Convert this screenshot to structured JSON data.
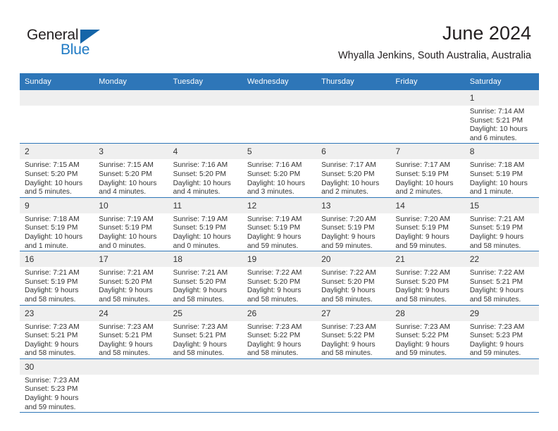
{
  "brand": {
    "name_top": "General",
    "name_bottom": "Blue",
    "triangle_icon": "triangle-icon",
    "accent_dark": "#1565a8",
    "accent_blue": "#1f7ac4"
  },
  "header": {
    "title": "June 2024",
    "subtitle": "Whyalla Jenkins, South Australia, Australia"
  },
  "theme": {
    "header_blue": "#2e76b8",
    "daynum_band": "#efefef",
    "text": "#333333"
  },
  "weekday_headers": [
    "Sunday",
    "Monday",
    "Tuesday",
    "Wednesday",
    "Thursday",
    "Friday",
    "Saturday"
  ],
  "labels": {
    "sunrise_prefix": "Sunrise:",
    "sunset_prefix": "Sunset:",
    "daylight_prefix": "Daylight:"
  },
  "weeks": [
    [
      {
        "day": "",
        "empty": true,
        "l1": "",
        "l2": "",
        "l3": "",
        "l4": ""
      },
      {
        "day": "",
        "empty": true,
        "l1": "",
        "l2": "",
        "l3": "",
        "l4": ""
      },
      {
        "day": "",
        "empty": true,
        "l1": "",
        "l2": "",
        "l3": "",
        "l4": ""
      },
      {
        "day": "",
        "empty": true,
        "l1": "",
        "l2": "",
        "l3": "",
        "l4": ""
      },
      {
        "day": "",
        "empty": true,
        "l1": "",
        "l2": "",
        "l3": "",
        "l4": ""
      },
      {
        "day": "",
        "empty": true,
        "l1": "",
        "l2": "",
        "l3": "",
        "l4": ""
      },
      {
        "day": "1",
        "empty": false,
        "l1": "Sunrise: 7:14 AM",
        "l2": "Sunset: 5:21 PM",
        "l3": "Daylight: 10 hours",
        "l4": "and 6 minutes."
      }
    ],
    [
      {
        "day": "2",
        "empty": false,
        "l1": "Sunrise: 7:15 AM",
        "l2": "Sunset: 5:20 PM",
        "l3": "Daylight: 10 hours",
        "l4": "and 5 minutes."
      },
      {
        "day": "3",
        "empty": false,
        "l1": "Sunrise: 7:15 AM",
        "l2": "Sunset: 5:20 PM",
        "l3": "Daylight: 10 hours",
        "l4": "and 4 minutes."
      },
      {
        "day": "4",
        "empty": false,
        "l1": "Sunrise: 7:16 AM",
        "l2": "Sunset: 5:20 PM",
        "l3": "Daylight: 10 hours",
        "l4": "and 4 minutes."
      },
      {
        "day": "5",
        "empty": false,
        "l1": "Sunrise: 7:16 AM",
        "l2": "Sunset: 5:20 PM",
        "l3": "Daylight: 10 hours",
        "l4": "and 3 minutes."
      },
      {
        "day": "6",
        "empty": false,
        "l1": "Sunrise: 7:17 AM",
        "l2": "Sunset: 5:20 PM",
        "l3": "Daylight: 10 hours",
        "l4": "and 2 minutes."
      },
      {
        "day": "7",
        "empty": false,
        "l1": "Sunrise: 7:17 AM",
        "l2": "Sunset: 5:19 PM",
        "l3": "Daylight: 10 hours",
        "l4": "and 2 minutes."
      },
      {
        "day": "8",
        "empty": false,
        "l1": "Sunrise: 7:18 AM",
        "l2": "Sunset: 5:19 PM",
        "l3": "Daylight: 10 hours",
        "l4": "and 1 minute."
      }
    ],
    [
      {
        "day": "9",
        "empty": false,
        "l1": "Sunrise: 7:18 AM",
        "l2": "Sunset: 5:19 PM",
        "l3": "Daylight: 10 hours",
        "l4": "and 1 minute."
      },
      {
        "day": "10",
        "empty": false,
        "l1": "Sunrise: 7:19 AM",
        "l2": "Sunset: 5:19 PM",
        "l3": "Daylight: 10 hours",
        "l4": "and 0 minutes."
      },
      {
        "day": "11",
        "empty": false,
        "l1": "Sunrise: 7:19 AM",
        "l2": "Sunset: 5:19 PM",
        "l3": "Daylight: 10 hours",
        "l4": "and 0 minutes."
      },
      {
        "day": "12",
        "empty": false,
        "l1": "Sunrise: 7:19 AM",
        "l2": "Sunset: 5:19 PM",
        "l3": "Daylight: 9 hours",
        "l4": "and 59 minutes."
      },
      {
        "day": "13",
        "empty": false,
        "l1": "Sunrise: 7:20 AM",
        "l2": "Sunset: 5:19 PM",
        "l3": "Daylight: 9 hours",
        "l4": "and 59 minutes."
      },
      {
        "day": "14",
        "empty": false,
        "l1": "Sunrise: 7:20 AM",
        "l2": "Sunset: 5:19 PM",
        "l3": "Daylight: 9 hours",
        "l4": "and 59 minutes."
      },
      {
        "day": "15",
        "empty": false,
        "l1": "Sunrise: 7:21 AM",
        "l2": "Sunset: 5:19 PM",
        "l3": "Daylight: 9 hours",
        "l4": "and 58 minutes."
      }
    ],
    [
      {
        "day": "16",
        "empty": false,
        "l1": "Sunrise: 7:21 AM",
        "l2": "Sunset: 5:19 PM",
        "l3": "Daylight: 9 hours",
        "l4": "and 58 minutes."
      },
      {
        "day": "17",
        "empty": false,
        "l1": "Sunrise: 7:21 AM",
        "l2": "Sunset: 5:20 PM",
        "l3": "Daylight: 9 hours",
        "l4": "and 58 minutes."
      },
      {
        "day": "18",
        "empty": false,
        "l1": "Sunrise: 7:21 AM",
        "l2": "Sunset: 5:20 PM",
        "l3": "Daylight: 9 hours",
        "l4": "and 58 minutes."
      },
      {
        "day": "19",
        "empty": false,
        "l1": "Sunrise: 7:22 AM",
        "l2": "Sunset: 5:20 PM",
        "l3": "Daylight: 9 hours",
        "l4": "and 58 minutes."
      },
      {
        "day": "20",
        "empty": false,
        "l1": "Sunrise: 7:22 AM",
        "l2": "Sunset: 5:20 PM",
        "l3": "Daylight: 9 hours",
        "l4": "and 58 minutes."
      },
      {
        "day": "21",
        "empty": false,
        "l1": "Sunrise: 7:22 AM",
        "l2": "Sunset: 5:20 PM",
        "l3": "Daylight: 9 hours",
        "l4": "and 58 minutes."
      },
      {
        "day": "22",
        "empty": false,
        "l1": "Sunrise: 7:22 AM",
        "l2": "Sunset: 5:21 PM",
        "l3": "Daylight: 9 hours",
        "l4": "and 58 minutes."
      }
    ],
    [
      {
        "day": "23",
        "empty": false,
        "l1": "Sunrise: 7:23 AM",
        "l2": "Sunset: 5:21 PM",
        "l3": "Daylight: 9 hours",
        "l4": "and 58 minutes."
      },
      {
        "day": "24",
        "empty": false,
        "l1": "Sunrise: 7:23 AM",
        "l2": "Sunset: 5:21 PM",
        "l3": "Daylight: 9 hours",
        "l4": "and 58 minutes."
      },
      {
        "day": "25",
        "empty": false,
        "l1": "Sunrise: 7:23 AM",
        "l2": "Sunset: 5:21 PM",
        "l3": "Daylight: 9 hours",
        "l4": "and 58 minutes."
      },
      {
        "day": "26",
        "empty": false,
        "l1": "Sunrise: 7:23 AM",
        "l2": "Sunset: 5:22 PM",
        "l3": "Daylight: 9 hours",
        "l4": "and 58 minutes."
      },
      {
        "day": "27",
        "empty": false,
        "l1": "Sunrise: 7:23 AM",
        "l2": "Sunset: 5:22 PM",
        "l3": "Daylight: 9 hours",
        "l4": "and 58 minutes."
      },
      {
        "day": "28",
        "empty": false,
        "l1": "Sunrise: 7:23 AM",
        "l2": "Sunset: 5:22 PM",
        "l3": "Daylight: 9 hours",
        "l4": "and 59 minutes."
      },
      {
        "day": "29",
        "empty": false,
        "l1": "Sunrise: 7:23 AM",
        "l2": "Sunset: 5:23 PM",
        "l3": "Daylight: 9 hours",
        "l4": "and 59 minutes."
      }
    ],
    [
      {
        "day": "30",
        "empty": false,
        "l1": "Sunrise: 7:23 AM",
        "l2": "Sunset: 5:23 PM",
        "l3": "Daylight: 9 hours",
        "l4": "and 59 minutes."
      },
      {
        "day": "",
        "empty": true,
        "l1": "",
        "l2": "",
        "l3": "",
        "l4": ""
      },
      {
        "day": "",
        "empty": true,
        "l1": "",
        "l2": "",
        "l3": "",
        "l4": ""
      },
      {
        "day": "",
        "empty": true,
        "l1": "",
        "l2": "",
        "l3": "",
        "l4": ""
      },
      {
        "day": "",
        "empty": true,
        "l1": "",
        "l2": "",
        "l3": "",
        "l4": ""
      },
      {
        "day": "",
        "empty": true,
        "l1": "",
        "l2": "",
        "l3": "",
        "l4": ""
      },
      {
        "day": "",
        "empty": true,
        "l1": "",
        "l2": "",
        "l3": "",
        "l4": ""
      }
    ]
  ]
}
